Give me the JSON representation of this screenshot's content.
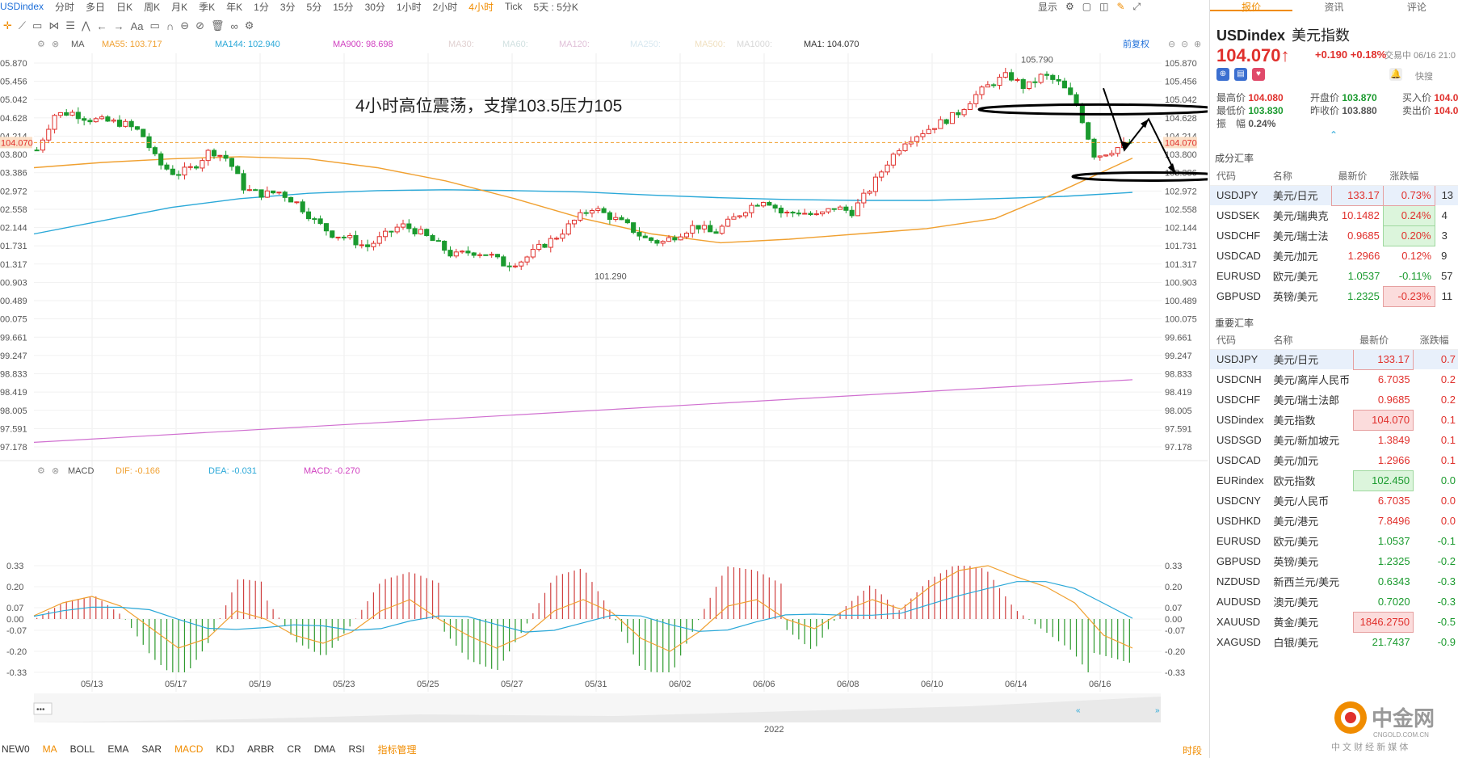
{
  "symbol": "USDindex",
  "period_tabs": [
    "分时",
    "多日",
    "日K",
    "周K",
    "月K",
    "季K",
    "年K",
    "1分",
    "3分",
    "5分",
    "15分",
    "30分",
    "1小时",
    "2小时",
    "4小时",
    "Tick",
    "5天 : 5分K"
  ],
  "active_tab": "4小时",
  "top_right": {
    "display": "显示"
  },
  "toolbar_labels": {
    "aa": "Aa"
  },
  "ma_bar": {
    "label": "MA",
    "items": [
      {
        "text": "MA55: 103.717",
        "color": "#f0a030"
      },
      {
        "text": "MA144: 102.940",
        "color": "#2aa8d8"
      },
      {
        "text": "MA900: 98.698",
        "color": "#d040c0"
      },
      {
        "text": "MA30:",
        "color": "#e0d0d0"
      },
      {
        "text": "MA60:",
        "color": "#d0e0e0"
      },
      {
        "text": "MA120:",
        "color": "#e0c0d8"
      },
      {
        "text": "MA250:",
        "color": "#d8e8f0"
      },
      {
        "text": "MA500:",
        "color": "#f0e0c0"
      },
      {
        "text": "MA1000:",
        "color": "#d8d8d8"
      },
      {
        "text": "MA1: 104.070",
        "color": "#333333"
      }
    ],
    "restore": "前复权"
  },
  "annotation": "4小时高位震荡，支撑103.5压力105",
  "price_axis": [
    "105.870",
    "105.456",
    "105.042",
    "104.628",
    "104.214",
    "103.800",
    "103.386",
    "102.972",
    "102.558",
    "102.144",
    "101.731",
    "101.317",
    "100.903",
    "100.489",
    "100.075",
    "99.661",
    "99.247",
    "98.833",
    "98.419",
    "98.005",
    "97.591",
    "97.178"
  ],
  "price_axis_left": [
    "05.870",
    "05.456",
    "05.042",
    "04.628",
    "04.214",
    "03.800",
    "03.386",
    "02.972",
    "02.558",
    "02.144",
    "01.731",
    "01.317",
    "00.903",
    "00.489",
    "00.075",
    "99.661",
    "99.247",
    "98.833",
    "98.419",
    "98.005",
    "97.591",
    "97.178"
  ],
  "current_price": "104.070",
  "high_label": "105.790",
  "low_label": "101.290",
  "macd_bar": {
    "label": "MACD",
    "items": [
      {
        "text": "DIF: -0.166",
        "color": "#f0a030"
      },
      {
        "text": "DEA: -0.031",
        "color": "#2aa8d8"
      },
      {
        "text": "MACD: -0.270",
        "color": "#d040c0"
      }
    ]
  },
  "macd_axis": [
    "0.33",
    "0.20",
    "0.07",
    "0.00",
    "-0.07",
    "-0.20",
    "-0.33"
  ],
  "date_axis": [
    "05/13",
    "05/17",
    "05/19",
    "05/23",
    "05/25",
    "05/27",
    "05/31",
    "06/02",
    "06/06",
    "06/08",
    "06/10",
    "06/14",
    "06/16"
  ],
  "year_label": "2022",
  "overview_dots": "•••",
  "overview_arrows": {
    "left": "«",
    "right": "»"
  },
  "indicators": [
    "NEW0",
    "MA",
    "BOLL",
    "EMA",
    "SAR",
    "MACD",
    "KDJ",
    "ARBR",
    "CR",
    "DMA",
    "RSI"
  ],
  "active_indicators": [
    "MA",
    "MACD"
  ],
  "indicator_manager": "指标管理",
  "time_btn": "时段",
  "panel": {
    "tabs": [
      "报价",
      "资讯",
      "评论"
    ],
    "title": "USDindex",
    "title_cn": "美元指数",
    "price": "104.070",
    "change": "+0.190",
    "change_pct": "+0.18%",
    "status": "交易中 06/16 21:0",
    "quote_left": [
      {
        "k": "最高价",
        "v": "104.080",
        "c": "red"
      },
      {
        "k": "最低价",
        "v": "103.830",
        "c": "green"
      },
      {
        "k": "振　幅",
        "v": "0.24%",
        "c": ""
      }
    ],
    "quote_mid": [
      {
        "k": "开盘价",
        "v": "103.870",
        "c": "green"
      },
      {
        "k": "昨收价",
        "v": "103.880",
        "c": ""
      }
    ],
    "quote_right": [
      {
        "k": "买入价",
        "v": "104.0",
        "c": "red"
      },
      {
        "k": "卖出价",
        "v": "104.0",
        "c": "red"
      }
    ],
    "quick": "快搜",
    "section1": "成分汇率",
    "section2": "重要汇率",
    "table_headers": [
      "代码",
      "名称",
      "最新价",
      "涨跌幅"
    ],
    "components": [
      {
        "code": "USDJPY",
        "name": "美元/日元",
        "price": "133.17",
        "pct": "0.73%",
        "extra": "13",
        "dir": "up",
        "sel": true
      },
      {
        "code": "USDSEK",
        "name": "美元/瑞典克",
        "price": "10.1482",
        "pct": "0.24%",
        "extra": "4",
        "dir": "upg"
      },
      {
        "code": "USDCHF",
        "name": "美元/瑞士法",
        "price": "0.9685",
        "pct": "0.20%",
        "extra": "3",
        "dir": "upg"
      },
      {
        "code": "USDCAD",
        "name": "美元/加元",
        "price": "1.2966",
        "pct": "0.12%",
        "extra": "9",
        "dir": "up"
      },
      {
        "code": "EURUSD",
        "name": "欧元/美元",
        "price": "1.0537",
        "pct": "-0.11%",
        "extra": "57",
        "dir": "dn"
      },
      {
        "code": "GBPUSD",
        "name": "英镑/美元",
        "price": "1.2325",
        "pct": "-0.23%",
        "extra": "11",
        "dir": "dnr"
      }
    ],
    "important": [
      {
        "code": "USDJPY",
        "name": "美元/日元",
        "price": "133.17",
        "pct": "0.7",
        "dir": "upbox",
        "sel": true
      },
      {
        "code": "USDCNH",
        "name": "美元/离岸人民币",
        "price": "6.7035",
        "pct": "0.2",
        "dir": "up"
      },
      {
        "code": "USDCHF",
        "name": "美元/瑞士法郎",
        "price": "0.9685",
        "pct": "0.2",
        "dir": "up"
      },
      {
        "code": "USDindex",
        "name": "美元指数",
        "price": "104.070",
        "pct": "0.1",
        "dir": "upbox"
      },
      {
        "code": "USDSGD",
        "name": "美元/新加坡元",
        "price": "1.3849",
        "pct": "0.1",
        "dir": "up"
      },
      {
        "code": "USDCAD",
        "name": "美元/加元",
        "price": "1.2966",
        "pct": "0.1",
        "dir": "up"
      },
      {
        "code": "EURindex",
        "name": "欧元指数",
        "price": "102.450",
        "pct": "0.0",
        "dir": "gbox"
      },
      {
        "code": "USDCNY",
        "name": "美元/人民币",
        "price": "6.7035",
        "pct": "0.0",
        "dir": "up"
      },
      {
        "code": "USDHKD",
        "name": "美元/港元",
        "price": "7.8496",
        "pct": "0.0",
        "dir": "up"
      },
      {
        "code": "EURUSD",
        "name": "欧元/美元",
        "price": "1.0537",
        "pct": "-0.1",
        "dir": "dn"
      },
      {
        "code": "GBPUSD",
        "name": "英镑/美元",
        "price": "1.2325",
        "pct": "-0.2",
        "dir": "dnr"
      },
      {
        "code": "NZDUSD",
        "name": "新西兰元/美元",
        "price": "0.6343",
        "pct": "-0.3",
        "dir": "dn"
      },
      {
        "code": "AUDUSD",
        "name": "澳元/美元",
        "price": "0.7020",
        "pct": "-0.3",
        "dir": "dn"
      },
      {
        "code": "XAUUSD",
        "name": "黄金/美元",
        "price": "1846.2750",
        "pct": "-0.5",
        "dir": "dnrbox"
      },
      {
        "code": "XAGUSD",
        "name": "白银/美元",
        "price": "21.7437",
        "pct": "-0.9",
        "dir": "dn"
      }
    ]
  },
  "logo": {
    "text": "中金网",
    "sub": "CNGOLD.COM.CN",
    "slogan": "中 文 财 经 新 媒 体"
  },
  "colors": {
    "up": "#e0302c",
    "down": "#1a9a2e",
    "accent": "#f08c00",
    "ma55": "#f0a030",
    "ma144": "#2aa8d8",
    "ma900": "#d040c0"
  },
  "chart_data": {
    "type": "candlestick",
    "timeframe": "4小时",
    "x": [
      "05/13",
      "05/17",
      "05/19",
      "05/23",
      "05/25",
      "05/27",
      "05/31",
      "06/02",
      "06/06",
      "06/08",
      "06/10",
      "06/14",
      "06/16"
    ],
    "ylim": [
      97.178,
      105.87
    ],
    "close_path": [
      103.9,
      104.7,
      104.75,
      104.6,
      104.55,
      104.5,
      104.3,
      103.6,
      103.35,
      103.5,
      103.9,
      103.7,
      103.0,
      102.9,
      102.95,
      102.7,
      102.3,
      102.0,
      101.9,
      101.7,
      101.95,
      102.2,
      102.05,
      101.8,
      101.5,
      101.6,
      101.55,
      101.3,
      101.4,
      101.7,
      101.95,
      102.3,
      102.6,
      102.4,
      102.2,
      101.9,
      101.8,
      102.0,
      102.2,
      102.0,
      102.3,
      102.6,
      102.8,
      102.45,
      102.5,
      102.4,
      102.6,
      102.5,
      103.0,
      103.6,
      104.1,
      104.3,
      104.5,
      104.7,
      105.1,
      105.4,
      105.6,
      105.3,
      105.6,
      105.4,
      104.9,
      103.75,
      103.9,
      104.07
    ],
    "ma_series": [
      {
        "name": "MA55",
        "last": 103.717
      },
      {
        "name": "MA144",
        "last": 102.94
      },
      {
        "name": "MA900",
        "last": 98.698
      }
    ],
    "labels": {
      "high": 105.79,
      "low": 101.29,
      "current": 104.07
    },
    "macd": {
      "dif": -0.166,
      "dea": -0.031,
      "macd": -0.27,
      "ylim": [
        -0.33,
        0.33
      ]
    }
  }
}
